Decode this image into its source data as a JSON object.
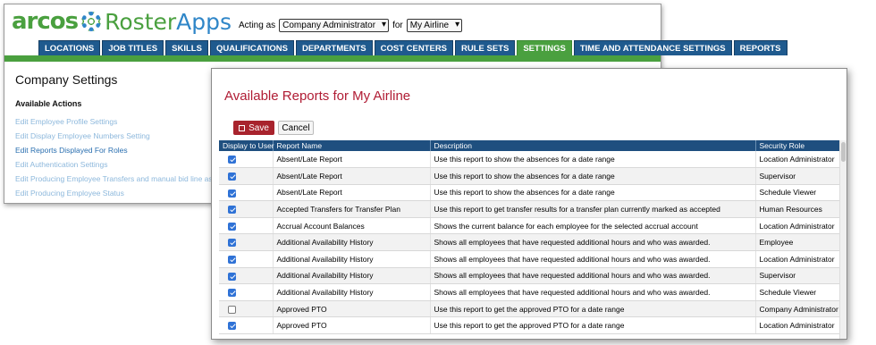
{
  "app": {
    "logo_brand": "arcos",
    "logo_product_a": "Roster",
    "logo_product_b": "Apps",
    "acting_as_label": "Acting as",
    "acting_as_value": "Company Administrator",
    "for_label": "for",
    "for_value": "My Airline"
  },
  "nav": [
    {
      "label": "LOCATIONS",
      "active": false
    },
    {
      "label": "JOB TITLES",
      "active": false
    },
    {
      "label": "SKILLS",
      "active": false
    },
    {
      "label": "QUALIFICATIONS",
      "active": false
    },
    {
      "label": "DEPARTMENTS",
      "active": false
    },
    {
      "label": "COST CENTERS",
      "active": false
    },
    {
      "label": "RULE SETS",
      "active": false
    },
    {
      "label": "SETTINGS",
      "active": true
    },
    {
      "label": "TIME AND ATTENDANCE SETTINGS",
      "active": false
    },
    {
      "label": "REPORTS",
      "active": false
    }
  ],
  "company": {
    "title": "Company Settings",
    "actions_title": "Available Actions",
    "actions": [
      {
        "label": "Edit Employee Profile Settings",
        "active": false
      },
      {
        "label": "Edit Display Employee Numbers Setting",
        "active": false
      },
      {
        "label": "Edit Reports Displayed For Roles",
        "active": true
      },
      {
        "label": "Edit Authentication Settings",
        "active": false
      },
      {
        "label": "Edit Producing Employee Transfers and manual bid line assignments",
        "active": false
      },
      {
        "label": "Edit Producing Employee Status",
        "active": false
      }
    ]
  },
  "dialog": {
    "title": "Available Reports for My Airline",
    "save_label": "Save",
    "cancel_label": "Cancel",
    "columns": [
      "Display to User",
      "Report Name",
      "Description",
      "Security Role"
    ],
    "rows": [
      {
        "checked": true,
        "name": "Absent/Late Report",
        "description": "Use this report to show the absences for a date range",
        "role": "Location Administrator"
      },
      {
        "checked": true,
        "name": "Absent/Late Report",
        "description": "Use this report to show the absences for a date range",
        "role": "Supervisor"
      },
      {
        "checked": true,
        "name": "Absent/Late Report",
        "description": "Use this report to show the absences for a date range",
        "role": "Schedule Viewer"
      },
      {
        "checked": true,
        "name": "Accepted Transfers for Transfer Plan",
        "description": "Use this report to get transfer results for a transfer plan currently marked as accepted",
        "role": "Human Resources"
      },
      {
        "checked": true,
        "name": "Accrual Account Balances",
        "description": "Shows the current balance for each employee for the selected accrual account",
        "role": "Location Administrator"
      },
      {
        "checked": true,
        "name": "Additional Availability History",
        "description": "Shows all employees that have requested additional hours and who was awarded.",
        "role": "Employee"
      },
      {
        "checked": true,
        "name": "Additional Availability History",
        "description": "Shows all employees that have requested additional hours and who was awarded.",
        "role": "Location Administrator"
      },
      {
        "checked": true,
        "name": "Additional Availability History",
        "description": "Shows all employees that have requested additional hours and who was awarded.",
        "role": "Supervisor"
      },
      {
        "checked": true,
        "name": "Additional Availability History",
        "description": "Shows all employees that have requested additional hours and who was awarded.",
        "role": "Schedule Viewer"
      },
      {
        "checked": false,
        "name": "Approved PTO",
        "description": "Use this report to get the approved PTO for a date range",
        "role": "Company Administrator"
      },
      {
        "checked": true,
        "name": "Approved PTO",
        "description": "Use this report to get the approved PTO for a date range",
        "role": "Location Administrator"
      }
    ]
  },
  "colors": {
    "brand_green": "#4aa03f",
    "brand_blue": "#2f86c8",
    "nav_blue": "#1f5a8e",
    "dialog_title_red": "#b01c34",
    "save_button": "#a8232d"
  }
}
